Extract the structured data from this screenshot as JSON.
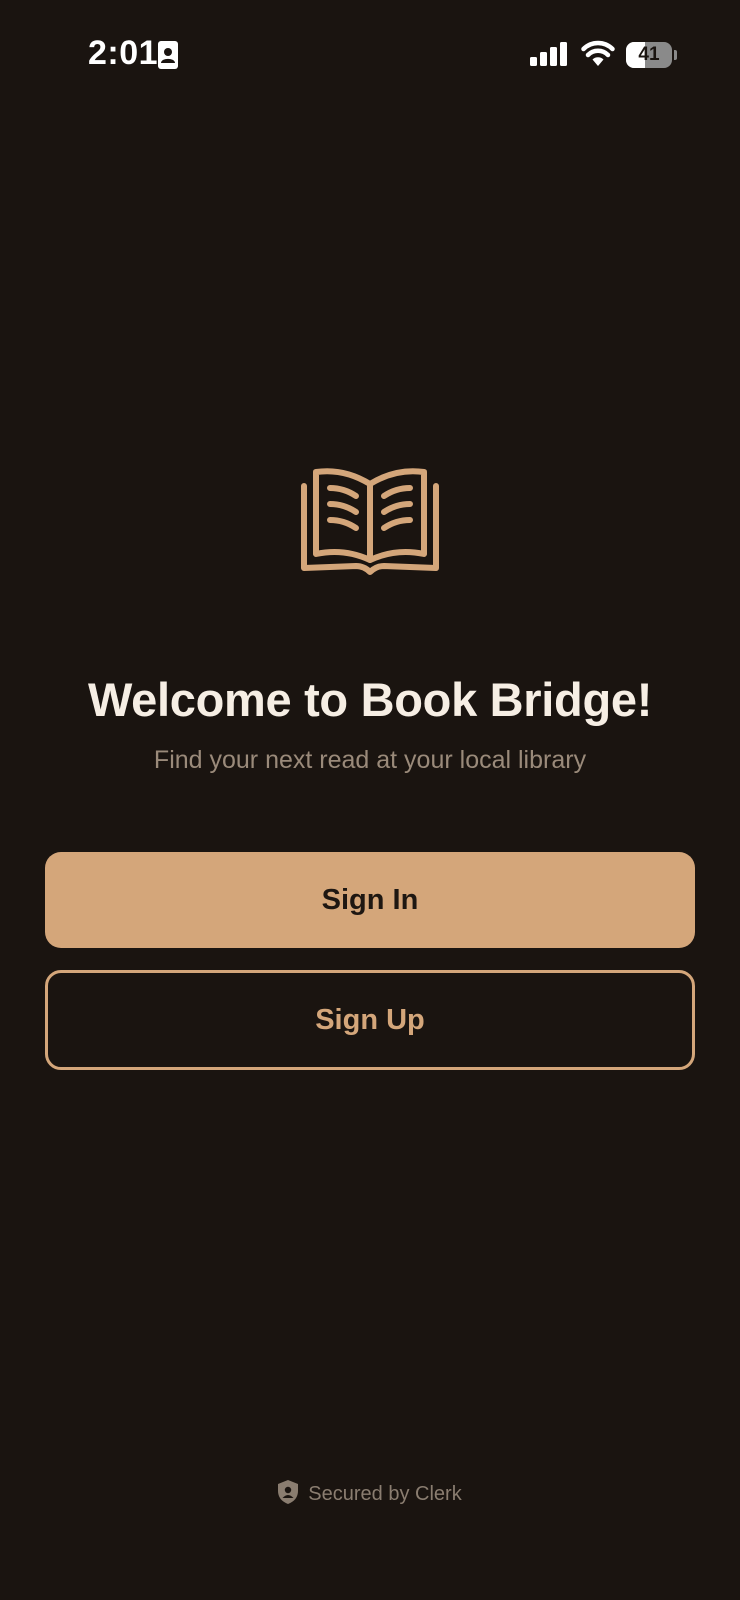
{
  "status_bar": {
    "time": "2:01",
    "battery_level": "41",
    "battery_fraction": 0.41
  },
  "hero": {
    "title": "Welcome to Book Bridge!",
    "subtitle": "Find your next read at your local library"
  },
  "actions": {
    "sign_in_label": "Sign In",
    "sign_up_label": "Sign Up"
  },
  "footer": {
    "text": "Secured by Clerk"
  },
  "icons": {
    "status": [
      "contact-card-icon",
      "cellular-signal-icon",
      "wifi-icon",
      "battery-icon"
    ],
    "hero": "open-book-icon",
    "footer": "shield-icon"
  },
  "colors": {
    "background": "#1a1410",
    "accent": "#d4a67a",
    "title_text": "#f6eee4",
    "muted_text": "#9a8a7a"
  }
}
